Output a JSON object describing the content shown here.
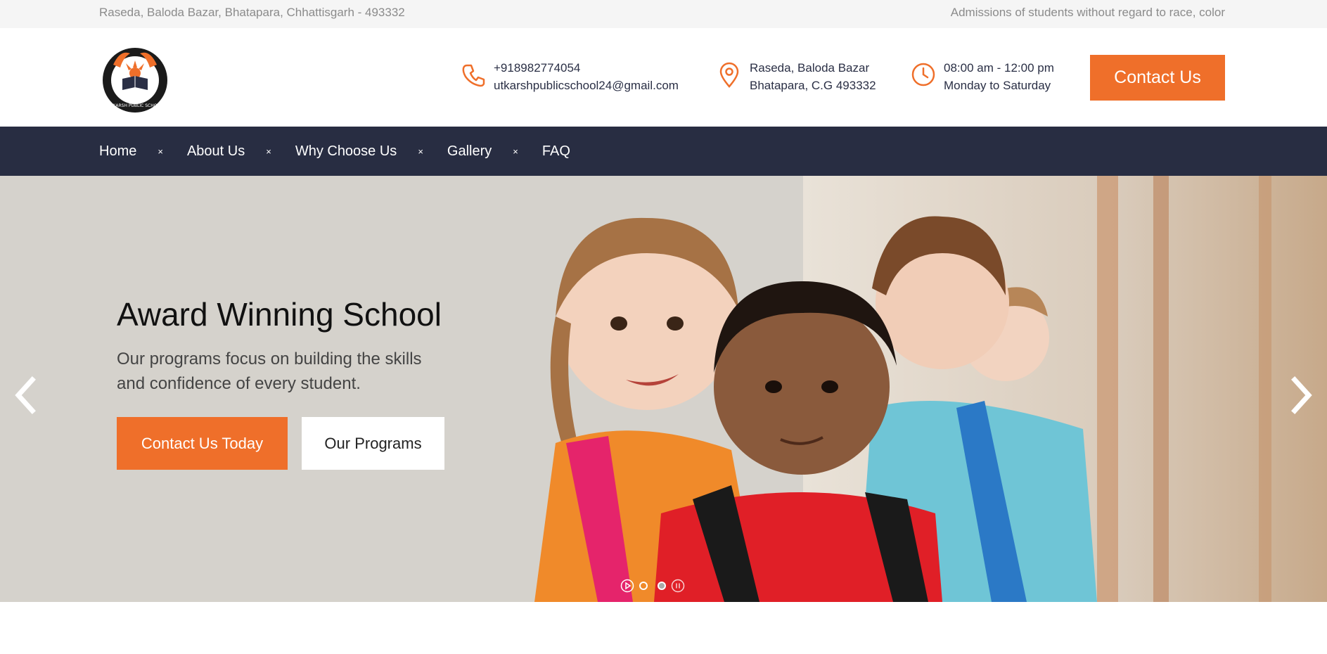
{
  "topbar": {
    "address": "Raseda, Baloda Bazar, Bhatapara, Chhattisgarh - 493332",
    "tagline": "Admissions of students without regard to race, color"
  },
  "header": {
    "logo_text": "UTKARSH PUBLIC SCHOOL",
    "phone": "+918982774054",
    "email": "utkarshpublicschool24@gmail.com",
    "address_line1": "Raseda, Baloda Bazar",
    "address_line2": "Bhatapara, C.G 493332",
    "hours": "08:00 am - 12:00 pm",
    "days": "Monday to Saturday",
    "contact_button": "Contact Us",
    "icons": [
      "phone-icon",
      "location-pin-icon",
      "clock-icon"
    ]
  },
  "nav": {
    "items": [
      "Home",
      "About Us",
      "Why Choose Us",
      "Gallery",
      "FAQ"
    ],
    "separator": "×"
  },
  "hero": {
    "title": "Award Winning School",
    "subtitle": "Our programs focus on building the skills and confidence of every student.",
    "primary_button": "Contact Us Today",
    "secondary_button": "Our Programs",
    "slides": 2,
    "active_slide": 2
  },
  "colors": {
    "accent": "#ef6f2a",
    "nav_bg": "#282d42",
    "topbar_bg": "#f5f5f5"
  }
}
